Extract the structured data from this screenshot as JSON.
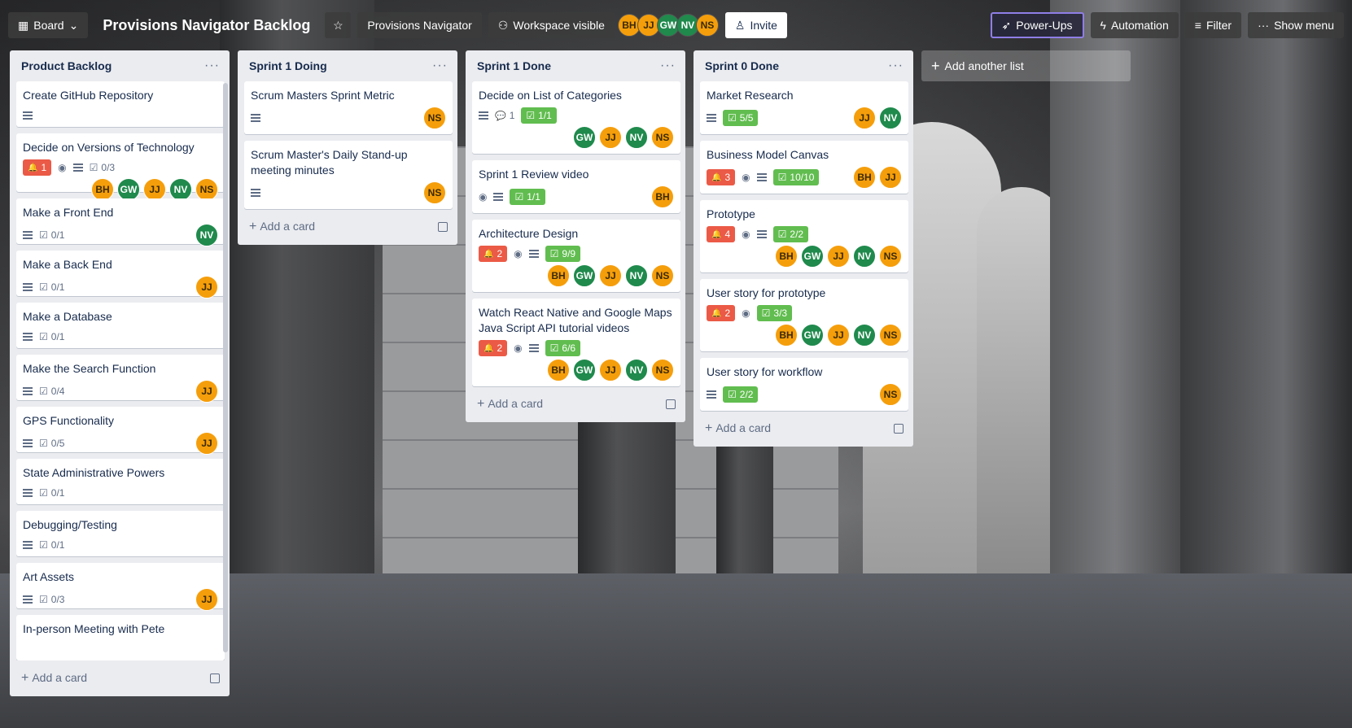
{
  "topbar": {
    "board_switcher": "Board",
    "board_title": "Provisions Navigator Backlog",
    "workspace": "Provisions Navigator",
    "visibility": "Workspace visible",
    "members": [
      {
        "initials": "BH",
        "color": "orange"
      },
      {
        "initials": "JJ",
        "color": "orange"
      },
      {
        "initials": "GW",
        "color": "green"
      },
      {
        "initials": "NV",
        "color": "green"
      },
      {
        "initials": "NS",
        "color": "orange"
      }
    ],
    "invite": "Invite",
    "powerups": "Power-Ups",
    "automation": "Automation",
    "filter": "Filter",
    "show_menu": "Show menu"
  },
  "add_card_label": "Add a card",
  "add_list_label": "Add another list",
  "lists": [
    {
      "title": "Product Backlog",
      "cards": [
        {
          "title": "Create GitHub Repository",
          "desc": true,
          "badges": [],
          "members": []
        },
        {
          "title": "Decide on Versions of Technology",
          "desc": true,
          "watch": true,
          "badges": [
            {
              "type": "red",
              "text": "1"
            },
            {
              "type": "check",
              "text": "0/3"
            }
          ],
          "members": [
            "BH",
            "GW",
            "JJ",
            "NV",
            "NS"
          ]
        },
        {
          "title": "Make a Front End",
          "desc": true,
          "badges": [
            {
              "type": "check",
              "text": "0/1"
            }
          ],
          "members": [
            "NV"
          ]
        },
        {
          "title": "Make a Back End",
          "desc": true,
          "badges": [
            {
              "type": "check",
              "text": "0/1"
            }
          ],
          "members": [
            "JJ"
          ]
        },
        {
          "title": "Make a Database",
          "desc": true,
          "badges": [
            {
              "type": "check",
              "text": "0/1"
            }
          ],
          "members": []
        },
        {
          "title": "Make the Search Function",
          "desc": true,
          "badges": [
            {
              "type": "check",
              "text": "0/4"
            }
          ],
          "members": [
            "JJ"
          ]
        },
        {
          "title": "GPS Functionality",
          "desc": true,
          "badges": [
            {
              "type": "check",
              "text": "0/5"
            }
          ],
          "members": [
            "JJ"
          ]
        },
        {
          "title": "State Administrative Powers",
          "desc": true,
          "badges": [
            {
              "type": "check",
              "text": "0/1"
            }
          ],
          "members": []
        },
        {
          "title": "Debugging/Testing",
          "desc": true,
          "badges": [
            {
              "type": "check",
              "text": "0/1"
            }
          ],
          "members": []
        },
        {
          "title": "Art Assets",
          "desc": true,
          "badges": [
            {
              "type": "check",
              "text": "0/3"
            }
          ],
          "members": [
            "JJ"
          ]
        },
        {
          "title": "In-person Meeting with Pete",
          "desc": false,
          "badges": [],
          "members": []
        }
      ]
    },
    {
      "title": "Sprint 1 Doing",
      "cards": [
        {
          "title": "Scrum Masters Sprint Metric",
          "desc": true,
          "badges": [],
          "members": [
            "NS"
          ]
        },
        {
          "title": "Scrum Master's Daily Stand-up meeting minutes",
          "desc": true,
          "badges": [],
          "members": [
            "NS"
          ]
        }
      ]
    },
    {
      "title": "Sprint 1 Done",
      "cards": [
        {
          "title": "Decide on List of Categories",
          "desc": true,
          "badges": [
            {
              "type": "comment",
              "text": "1"
            },
            {
              "type": "green",
              "text": "1/1"
            }
          ],
          "members": [
            "GW",
            "JJ",
            "NV",
            "NS"
          ]
        },
        {
          "title": "Sprint 1 Review video",
          "watch": true,
          "desc": true,
          "badges": [
            {
              "type": "green",
              "text": "1/1"
            }
          ],
          "members": [
            "BH"
          ]
        },
        {
          "title": "Architecture Design",
          "watch": true,
          "desc": true,
          "badges": [
            {
              "type": "red",
              "text": "2"
            },
            {
              "type": "green",
              "text": "9/9"
            }
          ],
          "members": [
            "BH",
            "GW",
            "JJ",
            "NV",
            "NS"
          ]
        },
        {
          "title": "Watch React Native and Google Maps Java Script API tutorial videos",
          "watch": true,
          "desc": true,
          "badges": [
            {
              "type": "red",
              "text": "2"
            },
            {
              "type": "green",
              "text": "6/6"
            }
          ],
          "members": [
            "BH",
            "GW",
            "JJ",
            "NV",
            "NS"
          ]
        }
      ]
    },
    {
      "title": "Sprint 0 Done",
      "cards": [
        {
          "title": "Market Research",
          "desc": true,
          "badges": [
            {
              "type": "green",
              "text": "5/5"
            }
          ],
          "members": [
            "JJ",
            "NV"
          ]
        },
        {
          "title": "Business Model Canvas",
          "watch": true,
          "desc": true,
          "badges": [
            {
              "type": "red",
              "text": "3"
            },
            {
              "type": "green",
              "text": "10/10"
            }
          ],
          "members": [
            "BH",
            "JJ"
          ]
        },
        {
          "title": "Prototype",
          "watch": true,
          "desc": true,
          "badges": [
            {
              "type": "red",
              "text": "4"
            },
            {
              "type": "green",
              "text": "2/2"
            }
          ],
          "members": [
            "BH",
            "GW",
            "JJ",
            "NV",
            "NS"
          ]
        },
        {
          "title": "User story for prototype",
          "watch": true,
          "desc": false,
          "badges": [
            {
              "type": "red",
              "text": "2"
            },
            {
              "type": "green",
              "text": "3/3"
            }
          ],
          "members": [
            "BH",
            "GW",
            "JJ",
            "NV",
            "NS"
          ]
        },
        {
          "title": "User story for workflow",
          "desc": true,
          "badges": [
            {
              "type": "green",
              "text": "2/2"
            }
          ],
          "members": [
            "NS"
          ]
        }
      ]
    }
  ],
  "member_colors": {
    "BH": "#f59e0b",
    "JJ": "#f59e0b",
    "NS": "#f59e0b",
    "GW": "#1f8a4c",
    "NV": "#1f8a4c"
  }
}
